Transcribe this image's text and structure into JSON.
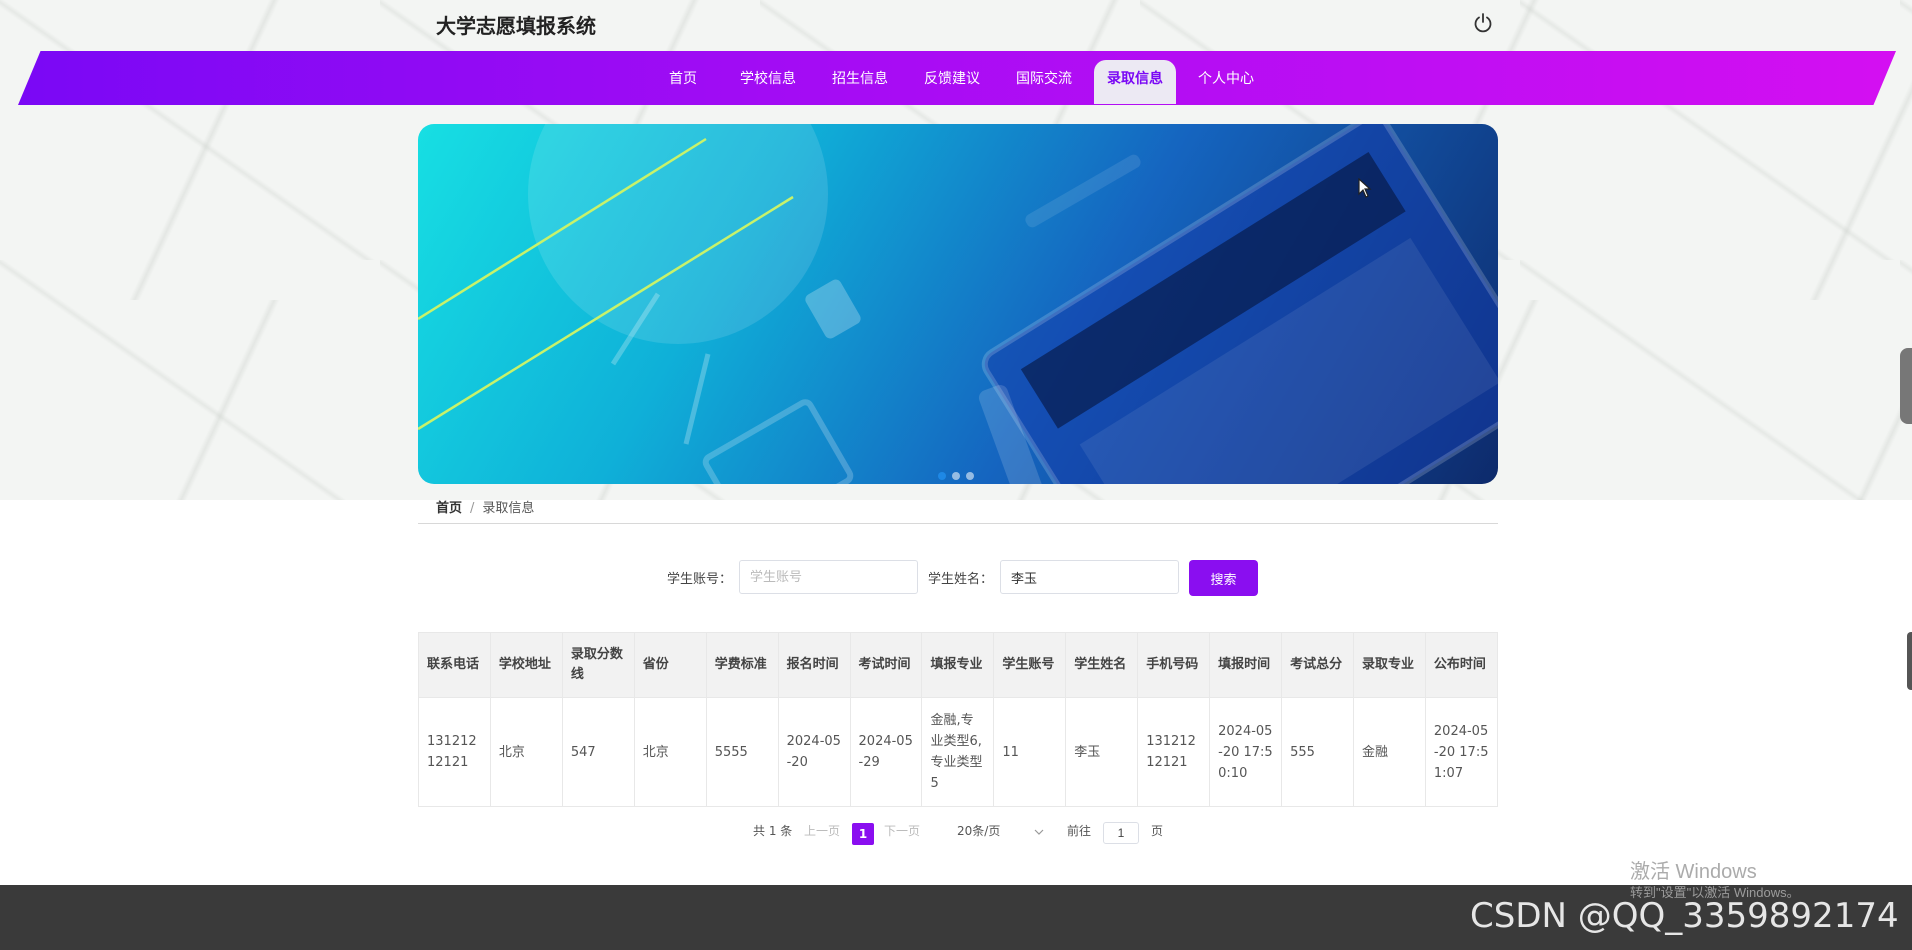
{
  "app": {
    "title": "大学志愿填报系统"
  },
  "nav": {
    "items": [
      {
        "label": "首页"
      },
      {
        "label": "学校信息"
      },
      {
        "label": "招生信息"
      },
      {
        "label": "反馈建议"
      },
      {
        "label": "国际交流"
      },
      {
        "label": "录取信息"
      },
      {
        "label": "个人中心"
      }
    ],
    "active_index": 5
  },
  "icons": {
    "power": "power-icon",
    "cursor": "mouse-cursor-icon"
  },
  "carousel": {
    "slide_count": 3,
    "active_slide": 1
  },
  "breadcrumb": {
    "home": "首页",
    "separator": "/",
    "current": "录取信息"
  },
  "search": {
    "account_label": "学生账号：",
    "account_placeholder": "学生账号",
    "account_value": "",
    "name_label": "学生姓名：",
    "name_value": "李玉",
    "button_label": "搜索"
  },
  "table": {
    "headers": [
      "联系电话",
      "学校地址",
      "录取分数线",
      "省份",
      "学费标准",
      "报名时间",
      "考试时间",
      "填报专业",
      "学生账号",
      "学生姓名",
      "手机号码",
      "填报时间",
      "考试总分",
      "录取专业",
      "公布时间"
    ],
    "rows": [
      [
        "13121212121",
        "北京",
        "547",
        "北京",
        "5555",
        "2024-05-20",
        "2024-05-29",
        "金融,专业类型6,专业类型5",
        "11",
        "李玉",
        "13121212121",
        "2024-05-20 17:50:10",
        "555",
        "金融",
        "2024-05-20 17:51:07"
      ]
    ]
  },
  "pagination": {
    "total": "共 1 条",
    "prev": "上一页",
    "current_page": "1",
    "next": "下一页",
    "page_size": "20条/页",
    "goto_label": "前往",
    "goto_value": "1",
    "page_unit": "页"
  },
  "overlay": {
    "activate_title": "激活 Windows",
    "activate_sub": "转到\"设置\"以激活 Windows。",
    "csdn": "CSDN @QQ_3359892174"
  },
  "colors": {
    "accent": "#8a0ef0",
    "nav_start": "#7a08f5",
    "nav_end": "#d40ff2",
    "footer": "#3a3a3a"
  }
}
